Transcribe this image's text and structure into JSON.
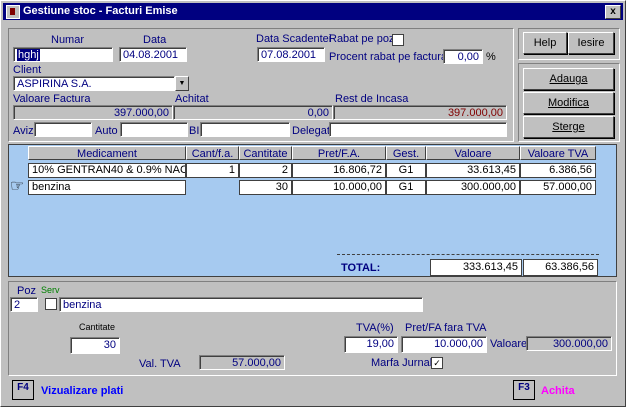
{
  "window": {
    "title": "Gestiune stoc - Facturi Emise",
    "close": "x"
  },
  "header": {
    "numar_label": "Numar",
    "numar": "hghj",
    "data_label": "Data",
    "data": "04.08.2001",
    "scadentei_label": "Data Scadentei",
    "scadentei": "07.08.2001",
    "rabat_label": "Rabat pe poz",
    "procent_label": "Procent rabat pe factura",
    "procent": "0,00",
    "procent_unit": "%",
    "client_label": "Client",
    "client": "ASPIRINA S.A.",
    "valoare_label": "Valoare Factura",
    "valoare": "397.000,00",
    "achitat_label": "Achitat",
    "achitat": "0,00",
    "rest_label": "Rest de Incasa",
    "rest": "397.000,00",
    "aviz_label": "Aviz",
    "aviz": "",
    "auto_label": "Auto",
    "auto": "",
    "bi_label": "BI",
    "bi": "",
    "delegat_label": "Delegat",
    "delegat": ""
  },
  "buttons": {
    "help": "Help",
    "iesire": "Iesire",
    "adauga": "Adauga",
    "modifica": "Modifica",
    "sterge": "Sterge"
  },
  "table": {
    "columns": [
      "Medicament",
      "Cant/f.a.",
      "Cantitate",
      "Pret/F.A.",
      "Gest.",
      "Valoare",
      "Valoare TVA"
    ],
    "rows": [
      {
        "medicament": "10% GENTRAN40 & 0.9% NACL",
        "cantfa": "1",
        "cantitate": "2",
        "pret": "16.806,72",
        "gest": "G1",
        "valoare": "33.613,45",
        "tva": "6.386,56"
      },
      {
        "medicament": "benzina",
        "cantfa": "",
        "cantitate": "30",
        "pret": "10.000,00",
        "gest": "G1",
        "valoare": "300.000,00",
        "tva": "57.000,00"
      }
    ],
    "total_label": "TOTAL:",
    "total_valoare": "333.613,45",
    "total_tva": "63.386,56"
  },
  "detail": {
    "poz_label": "Poz",
    "poz": "2",
    "serv_label": "Serv",
    "medicament": "benzina",
    "cantitate_label": "Cantitate",
    "cantitate": "30",
    "tva_label": "TVA(%)",
    "tva": "19,00",
    "pretfa_label": "Pret/FA fara TVA",
    "pretfa": "10.000,00",
    "valoare_label": "Valoare:",
    "valoare": "300.000,00",
    "valtva_label": "Val. TVA",
    "valtva": "57.000,00",
    "marfa_label": "Marfa Jurnal",
    "marfa_checked": "✓"
  },
  "footer": {
    "f4_key": "F4",
    "f4_label": "Vizualizare plati",
    "f3_key": "F3",
    "f3_label": "Achita"
  },
  "colors": {
    "title_bg": "#000080",
    "grid_bg": "#a6caf0",
    "rest_color": "#800000",
    "achita_color": "#ff00ff"
  }
}
